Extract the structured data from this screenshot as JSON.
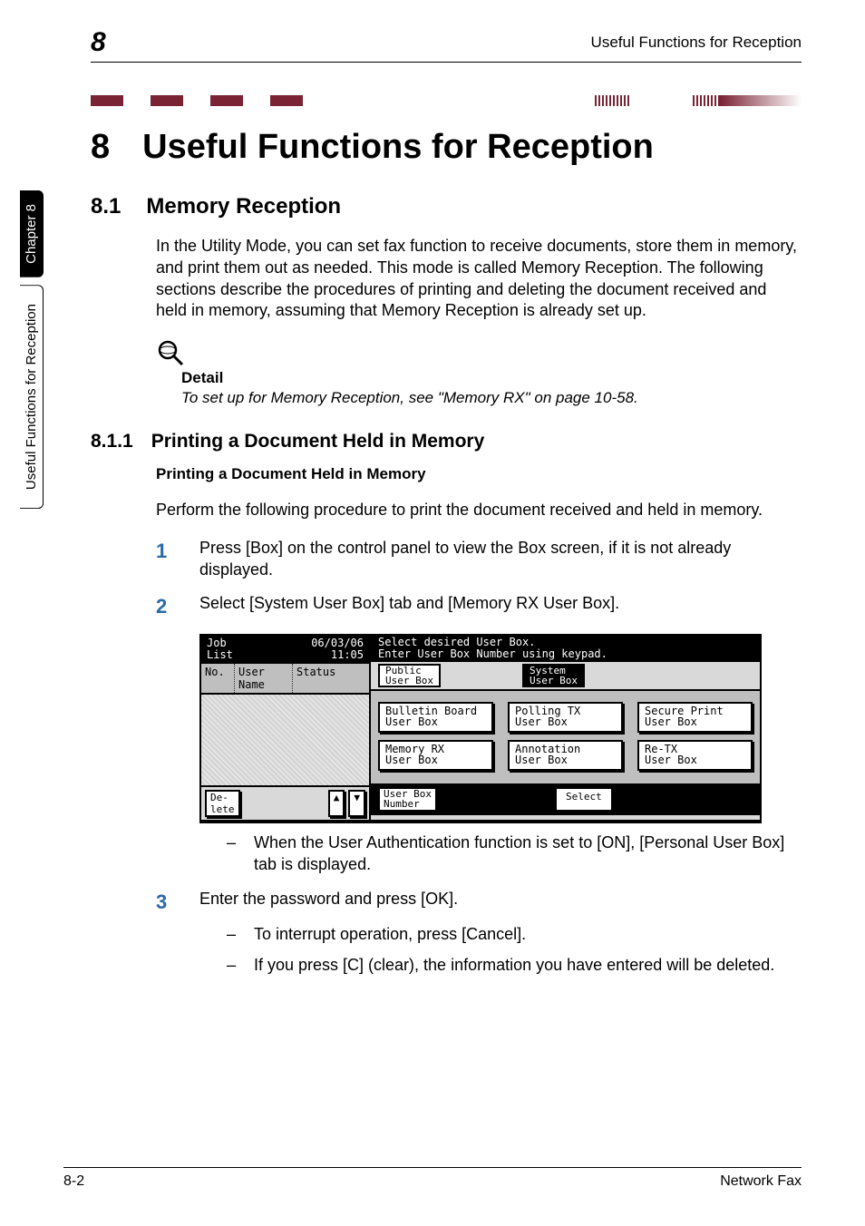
{
  "header": {
    "chapter_num": "8",
    "running_title": "Useful Functions for Reception"
  },
  "side_tabs": {
    "chapter": "Chapter 8",
    "section": "Useful Functions for Reception"
  },
  "h1": {
    "num": "8",
    "text": "Useful Functions for Reception"
  },
  "h2": {
    "num": "8.1",
    "text": "Memory Reception"
  },
  "intro_p": "In the Utility Mode, you can set fax function to receive documents, store them in memory, and print them out as needed. This mode is called Memory Reception. The following sections describe the procedures of printing and deleting the document received and held in memory, assuming that Memory Reception is already set up.",
  "detail": {
    "label": "Detail",
    "text": "To set up for Memory Reception, see \"Memory RX\" on page 10-58."
  },
  "h3": {
    "num": "8.1.1",
    "text": "Printing a Document Held in Memory"
  },
  "h4": "Printing a Document Held in Memory",
  "h4_p": "Perform the following procedure to print the document received and held in memory.",
  "steps": {
    "s1_num": "1",
    "s1": "Press [Box] on the control panel to view the Box screen, if it is not already displayed.",
    "s2_num": "2",
    "s2": "Select [System User Box] tab and [Memory RX User Box].",
    "s2_sub_a": "When the User Authentication function is set to [ON], [Personal User Box] tab is displayed.",
    "s3_num": "3",
    "s3": "Enter the password and press [OK].",
    "s3_sub_a": "To interrupt operation, press [Cancel].",
    "s3_sub_b": "If you press [C] (clear), the information you have entered will be deleted."
  },
  "lcd": {
    "job_list_label": "Job\nList",
    "datetime": "06/03/06\n11:05",
    "col_no": "No.",
    "col_user": "User\nName",
    "col_status": "Status",
    "delete_btn": "De-\nlete",
    "up_btn": "▲",
    "down_btn": "▼",
    "title_line1": "Select desired User Box.",
    "title_line2": "Enter User Box Number using keypad.",
    "tab_public": "Public\nUser Box",
    "tab_system": "System\nUser Box",
    "boxes": {
      "bulletin": "Bulletin Board\nUser Box",
      "polling": "Polling TX\nUser Box",
      "secure": "Secure Print\nUser Box",
      "memory": "Memory RX\nUser Box",
      "annotation": "Annotation\nUser Box",
      "retx": "Re-TX\nUser Box"
    },
    "userbox_number_btn": "User Box\nNumber",
    "select_btn": "Select"
  },
  "footer": {
    "left": "8-2",
    "right": "Network Fax"
  }
}
